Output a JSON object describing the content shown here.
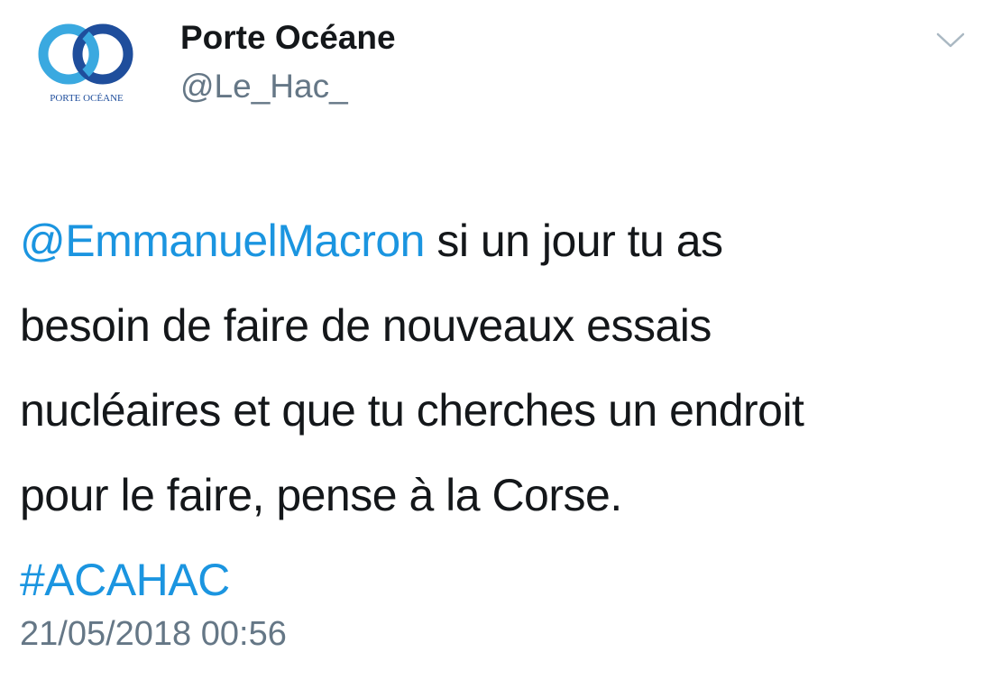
{
  "tweet": {
    "author": {
      "display_name": "Porte Océane",
      "handle": "@Le_Hac_",
      "avatar_logo_text": "PORTE OCÉANE"
    },
    "body": {
      "mention": "@EmmanuelMacron",
      "line1_rest": " si un jour tu as",
      "line2": "besoin de faire de nouveaux essais",
      "line3": "nucléaires et que tu cherches un endroit",
      "line4": "pour le faire, pense à la Corse.",
      "hashtag": "#ACAHAC"
    },
    "timestamp": "21/05/2018 00:56",
    "menu_icon": "chevron-down-icon"
  },
  "colors": {
    "link": "#1b95e0",
    "secondary_text": "#657786",
    "primary_text": "#14171a",
    "logo_light_blue": "#3aa9e0",
    "logo_dark_blue": "#1f4e9c"
  }
}
